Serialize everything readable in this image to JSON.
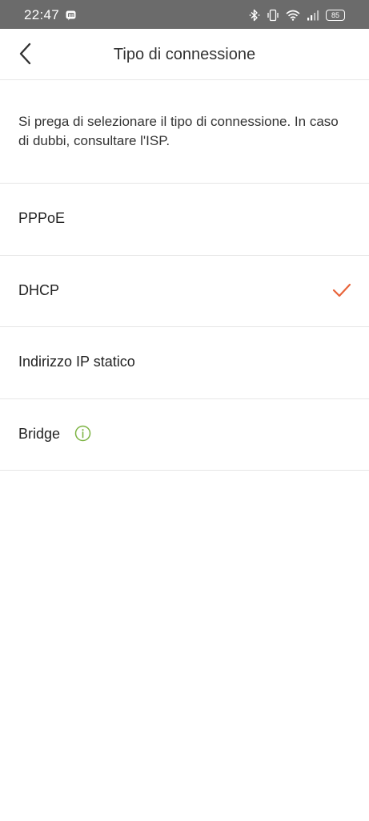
{
  "status_bar": {
    "time": "22:47",
    "battery": "85",
    "icons": [
      "app-notification-icon",
      "bluetooth-icon",
      "vibrate-icon",
      "wifi-icon",
      "signal-icon",
      "battery-icon"
    ]
  },
  "header": {
    "title": "Tipo di connessione",
    "back_icon": "chevron-left-icon"
  },
  "description": "Si prega di selezionare il tipo di connessione. In caso di dubbi, consultare l'ISP.",
  "options": [
    {
      "label": "PPPoE",
      "selected": false
    },
    {
      "label": "DHCP",
      "selected": true
    },
    {
      "label": "Indirizzo IP statico",
      "selected": false
    },
    {
      "label": "Bridge",
      "selected": false,
      "icon": "info-icon"
    }
  ],
  "colors": {
    "accent": "#e8643a",
    "info": "#7cb342",
    "divider": "#e6e6e6",
    "status_bar": "#6b6b6b"
  }
}
